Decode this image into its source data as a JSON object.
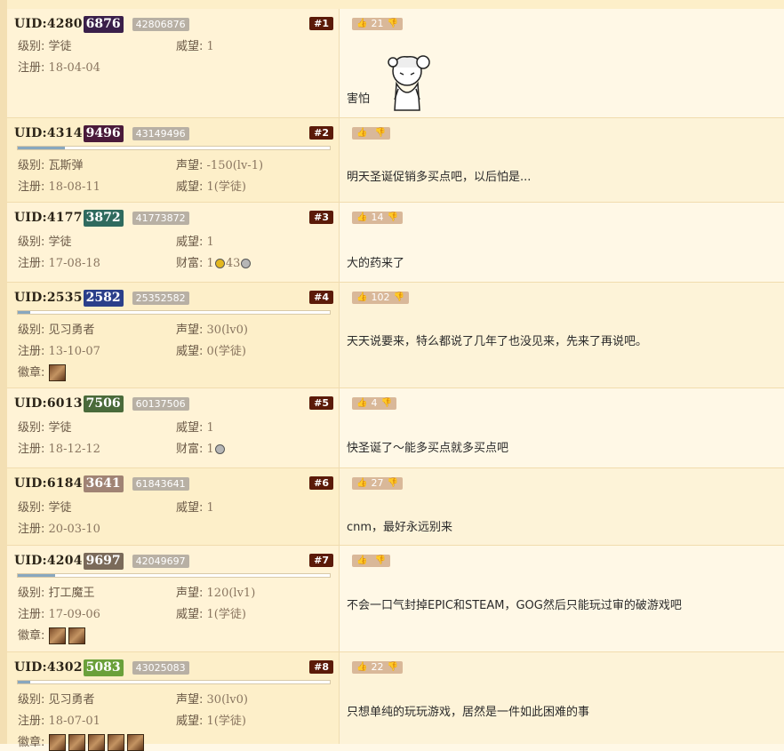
{
  "labels": {
    "level": "级别:",
    "prestige": "威望:",
    "reputation": "声望:",
    "registered": "注册:",
    "wealth": "财富:",
    "medals": "徽章:"
  },
  "posts": [
    {
      "uid_prefix": "UID:4280",
      "uid_suffix": "6876",
      "uid_color": "#3a1f4a",
      "uid_tag": "42806876",
      "floor": "#1",
      "level": "学徒",
      "prestige": "1",
      "registered": "18-04-04",
      "votes": "21",
      "text": "害怕"
    },
    {
      "uid_prefix": "UID:4314",
      "uid_suffix": "9496",
      "uid_color": "#4a1a3a",
      "uid_tag": "43149496",
      "floor": "#2",
      "level": "瓦斯弹",
      "reputation": "-150(lv-1)",
      "registered": "18-08-11",
      "prestige": "1(学徒)",
      "votes": "",
      "text": "明天圣诞促销多买点吧，以后怕是..."
    },
    {
      "uid_prefix": "UID:4177",
      "uid_suffix": "3872",
      "uid_color": "#2f6a5e",
      "uid_tag": "41773872",
      "floor": "#3",
      "level": "学徒",
      "prestige": "1",
      "registered": "17-08-18",
      "wealth_a": "1",
      "wealth_b": "43",
      "votes": "14",
      "text": "大的药来了"
    },
    {
      "uid_prefix": "UID:2535",
      "uid_suffix": "2582",
      "uid_color": "#2b3f8a",
      "uid_tag": "25352582",
      "floor": "#4",
      "level": "见习勇者",
      "reputation": "30(lv0)",
      "registered": "13-10-07",
      "prestige": "0(学徒)",
      "votes": "102",
      "text": "天天说要来，特么都说了几年了也没见来，先来了再说吧。"
    },
    {
      "uid_prefix": "UID:6013",
      "uid_suffix": "7506",
      "uid_color": "#4a6a3a",
      "uid_tag": "60137506",
      "floor": "#5",
      "level": "学徒",
      "prestige": "1",
      "registered": "18-12-12",
      "wealth_a": "1",
      "votes": "4",
      "text": "快圣诞了～能多买点就多买点吧"
    },
    {
      "uid_prefix": "UID:6184",
      "uid_suffix": "3641",
      "uid_color": "#a08374",
      "uid_tag": "61843641",
      "floor": "#6",
      "level": "学徒",
      "prestige": "1",
      "registered": "20-03-10",
      "votes": "27",
      "text": "cnm，最好永远别来"
    },
    {
      "uid_prefix": "UID:4204",
      "uid_suffix": "9697",
      "uid_color": "#7a6a5a",
      "uid_tag": "42049697",
      "floor": "#7",
      "level": "打工魔王",
      "reputation": "120(lv1)",
      "registered": "17-09-06",
      "prestige": "1(学徒)",
      "votes": "",
      "text": "不会一口气封掉EPIC和STEAM，GOG然后只能玩过审的破游戏吧"
    },
    {
      "uid_prefix": "UID:4302",
      "uid_suffix": "5083",
      "uid_color": "#6aa03a",
      "uid_tag": "43025083",
      "floor": "#8",
      "level": "见习勇者",
      "reputation": "30(lv0)",
      "registered": "18-07-01",
      "prestige": "1(学徒)",
      "votes": "22",
      "text": "只想单纯的玩玩游戏，居然是一件如此困难的事"
    }
  ],
  "icons": {
    "upvote": "thumb-up-icon",
    "downvote": "thumb-down-icon",
    "sticker": "scared-anime-girl-sticker"
  }
}
